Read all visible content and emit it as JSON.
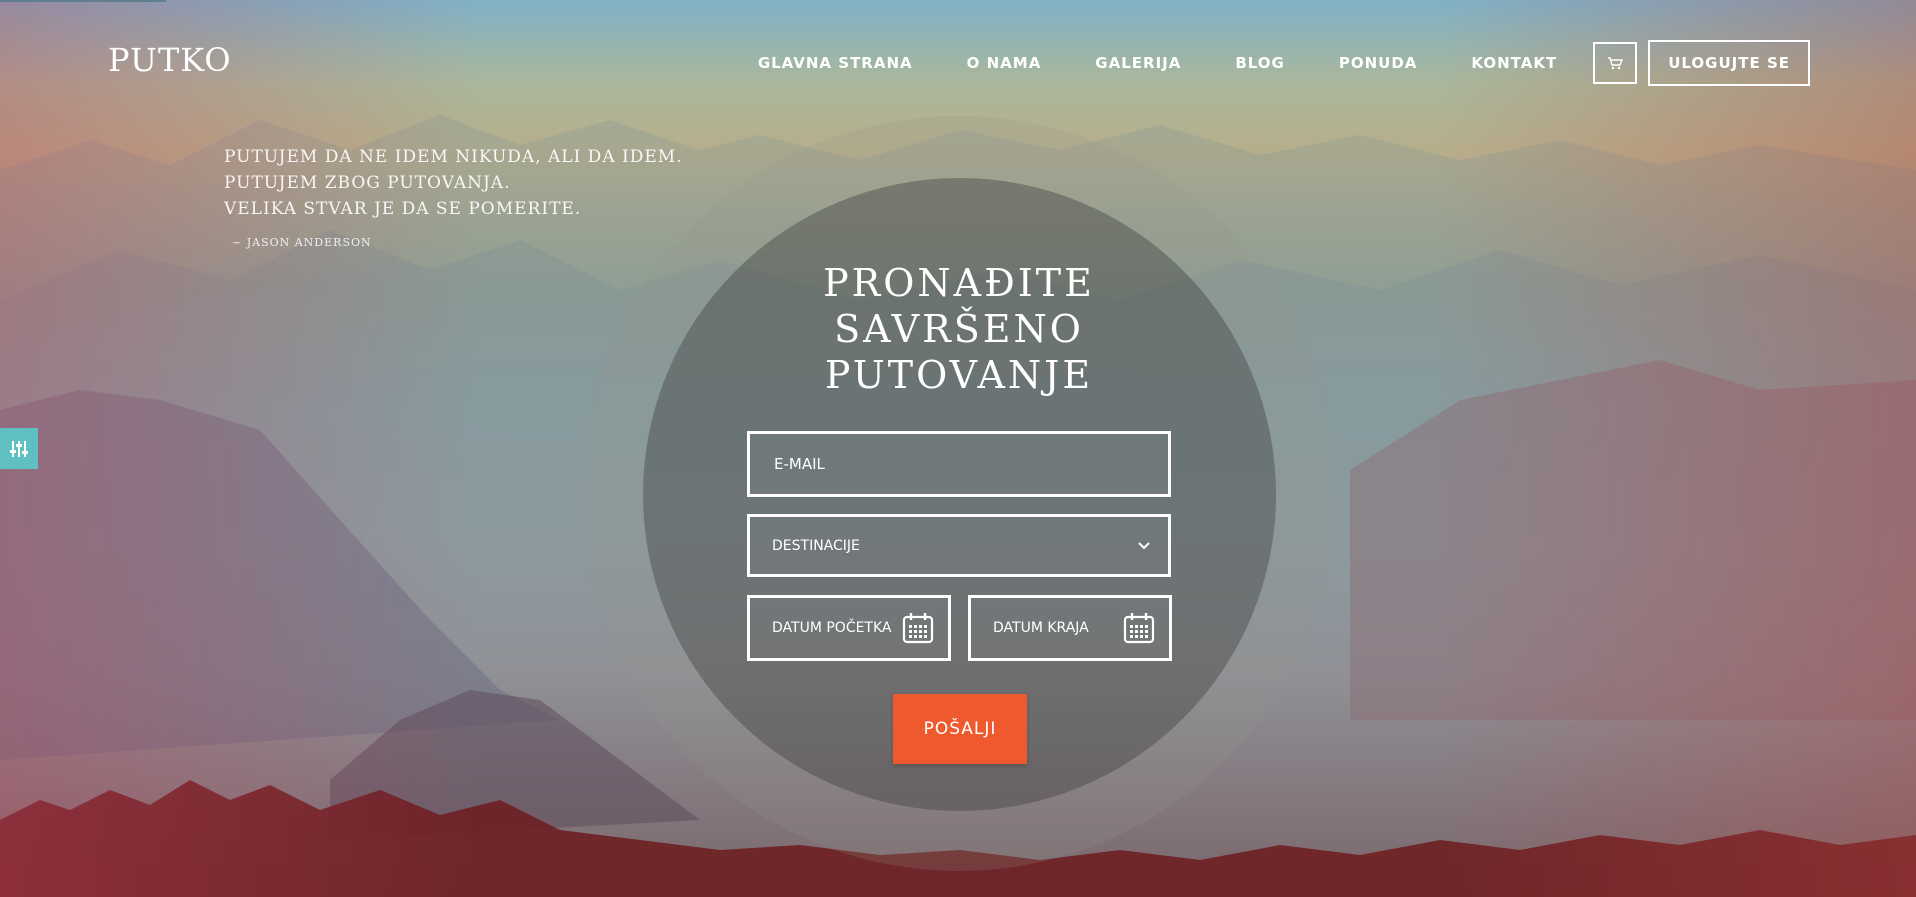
{
  "header": {
    "logo": "PUTKO",
    "nav": [
      "GLAVNA STRANA",
      "O NAMA",
      "GALERIJA",
      "BLOG",
      "PONUDA",
      "KONTAKT"
    ],
    "login_label": "ULOGUJTE SE",
    "cart_icon": "cart-icon"
  },
  "quote": {
    "lines": [
      "PUTUJEM DA NE IDEM NIKUDA, ALI DA IDEM.",
      "PUTUJEM ZBOG PUTOVANJA.",
      "VELIKA STVAR JE DA SE POMERITE."
    ],
    "author": "~ JASON ANDERSON"
  },
  "form": {
    "title_lines": [
      "PRONAĐITE",
      "SAVRŠENO",
      "PUTOVANJE"
    ],
    "email_placeholder": "E-MAIL",
    "destination_label": "DESTINACIJE",
    "start_date_label": "DATUM POČETKA",
    "end_date_label": "DATUM KRAJA",
    "submit_label": "POŠALJI"
  },
  "colors": {
    "accent": "#ee5a2e",
    "settings_tab": "#5fbfc1"
  }
}
